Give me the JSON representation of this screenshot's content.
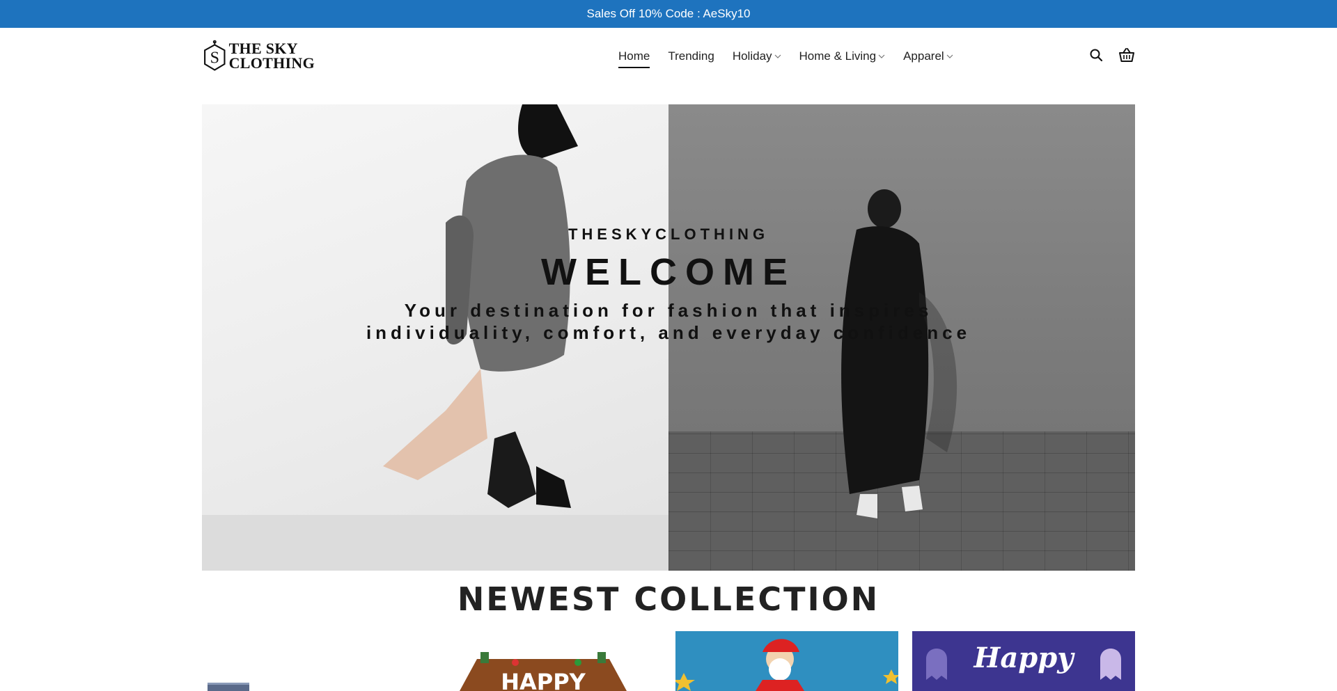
{
  "topbar": {
    "text": "Sales Off 10% Code : AeSky10"
  },
  "header": {
    "logo": {
      "line1": "THE SKY",
      "line2": "CLOTHING",
      "mark": "S"
    },
    "nav": [
      {
        "label": "Home",
        "active": true,
        "has_dropdown": false
      },
      {
        "label": "Trending",
        "active": false,
        "has_dropdown": false
      },
      {
        "label": "Holiday",
        "active": false,
        "has_dropdown": true
      },
      {
        "label": "Home & Living",
        "active": false,
        "has_dropdown": true
      },
      {
        "label": "Apparel",
        "active": false,
        "has_dropdown": true
      }
    ],
    "icons": [
      "search-icon",
      "cart-icon"
    ]
  },
  "hero": {
    "brand": "THESKYCLOTHING",
    "title": "WELCOME",
    "subtitle_line1": "Your destination for fashion that inspires",
    "subtitle_line2": "individuality, comfort, and everyday confidence"
  },
  "section": {
    "title": "NEWEST COLLECTION"
  },
  "thumbs": [
    {
      "caption": ""
    },
    {
      "caption": "HAPPY"
    },
    {
      "caption": ""
    },
    {
      "caption": "Happy"
    }
  ],
  "colors": {
    "topbar": "#1e73be",
    "text": "#111111"
  }
}
